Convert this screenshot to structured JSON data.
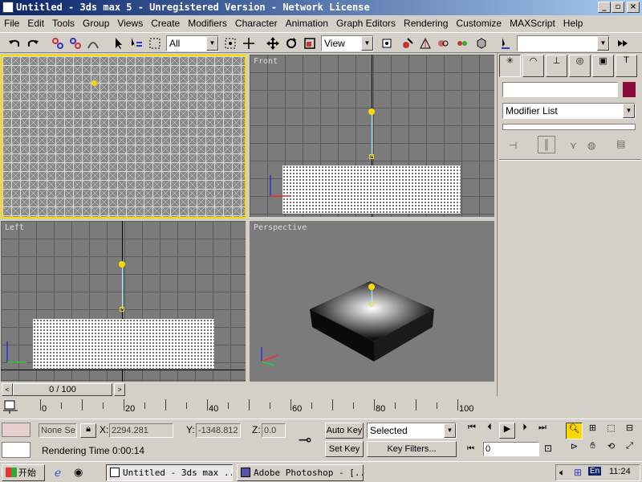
{
  "window": {
    "title": "Untitled - 3ds max 5 - Unregistered Version - Network License",
    "min_btn": "_",
    "max_btn": "▫",
    "close_btn": "×"
  },
  "menu": [
    "File",
    "Edit",
    "Tools",
    "Group",
    "Views",
    "Create",
    "Modifiers",
    "Character",
    "Animation",
    "Graph Editors",
    "Rendering",
    "Customize",
    "MAXScript",
    "Help"
  ],
  "toolbar": {
    "selection_filter": "All",
    "reference_coord": "View"
  },
  "viewports": {
    "top_left": {
      "label": ""
    },
    "front": {
      "label": "Front"
    },
    "left": {
      "label": "Left"
    },
    "perspective": {
      "label": "Perspective"
    }
  },
  "command_panel": {
    "modifier_list": "Modifier List",
    "color_swatch": "#8b0a3a"
  },
  "timeline": {
    "frame_display": "0 / 100",
    "ticks": [
      "0",
      "20",
      "40",
      "60",
      "80",
      "100"
    ],
    "prev_arrow": "<",
    "next_arrow": ">"
  },
  "status": {
    "selection": "None Se",
    "x_label": "X:",
    "x_value": "2294.281",
    "y_label": "Y:",
    "y_value": "-1348.812",
    "z_label": "Z:",
    "z_value": "0.0",
    "auto_key": "Auto Key",
    "set_key": "Set Key",
    "key_mode": "Selected",
    "key_filters": "Key Filters...",
    "rendering_time": "Rendering Time  0:00:14",
    "frame_value": "0"
  },
  "taskbar": {
    "start": "开始",
    "task1": "Untitled - 3ds max ...",
    "task2": "Adobe Photoshop - [...",
    "lang": "En",
    "clock": "11:24"
  },
  "colors": {
    "title_start": "#0a246a",
    "title_end": "#a6caf0",
    "active_viewport_border": "#ffd700",
    "viewport_bg": "#7b7b7b"
  }
}
